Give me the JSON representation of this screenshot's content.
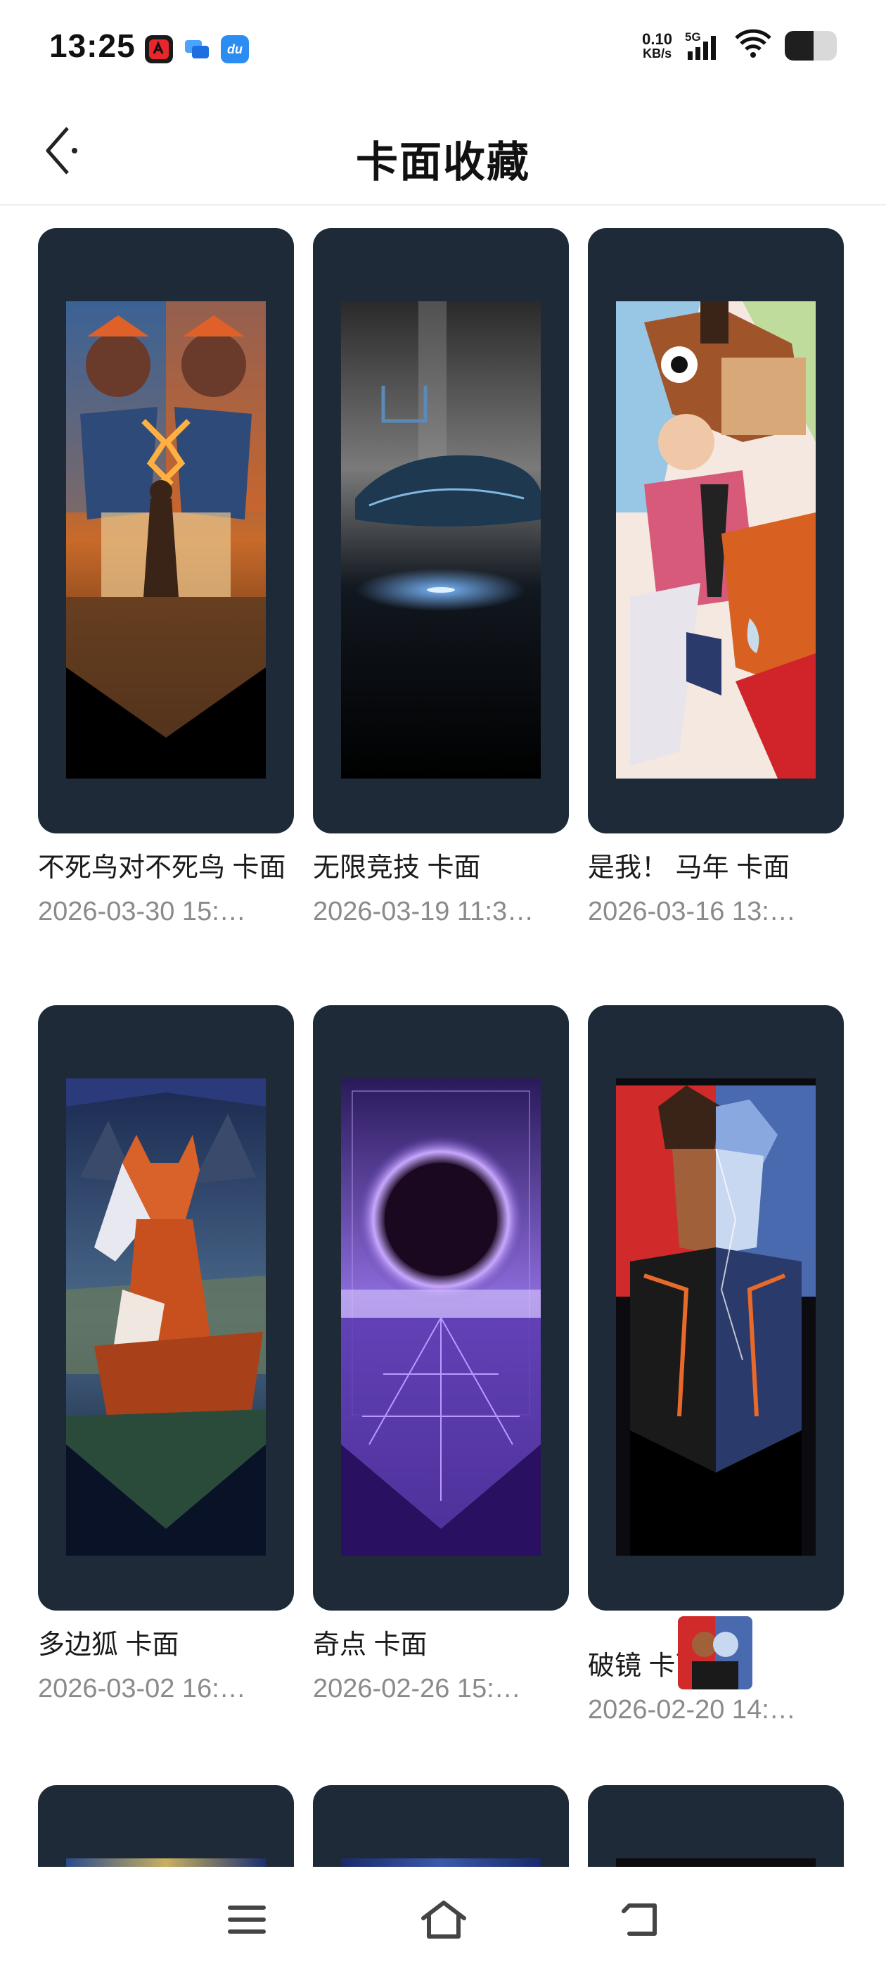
{
  "status_bar": {
    "time": "13:25",
    "app_icons": [
      "app-icon-red",
      "app-icon-chat",
      "app-icon-du"
    ],
    "du_label": "du",
    "net_speed_value": "0.10",
    "net_speed_unit": "KB/s",
    "signal_label": "5G",
    "battery_level": 0.55
  },
  "header": {
    "title": "卡面收藏"
  },
  "cards": [
    {
      "name": "不死鸟对不死鸟 卡面",
      "date": "2026-03-30 15:…",
      "art": "phoenix-vs-phoenix"
    },
    {
      "name": "无限竞技 卡面",
      "date": "2026-03-19 11:3…",
      "art": "infinite-racing"
    },
    {
      "name": "是我！ 马年 卡面",
      "date": "2026-03-16 13:…",
      "art": "horse-year"
    },
    {
      "name": "多边狐 卡面",
      "date": "2026-03-02 16:…",
      "art": "polygon-fox"
    },
    {
      "name": "奇点 卡面",
      "date": "2026-02-26 15:…",
      "art": "singularity"
    },
    {
      "name": "破镜 卡面",
      "date": "2026-02-20 14:…",
      "art": "broken-mirror"
    }
  ],
  "colors": {
    "card_bg": "#1e2a38",
    "date_text": "#8a8a8a",
    "title_text": "#111111"
  },
  "nav": {
    "icons": [
      "menu-icon",
      "home-icon",
      "back-nav-icon"
    ]
  }
}
